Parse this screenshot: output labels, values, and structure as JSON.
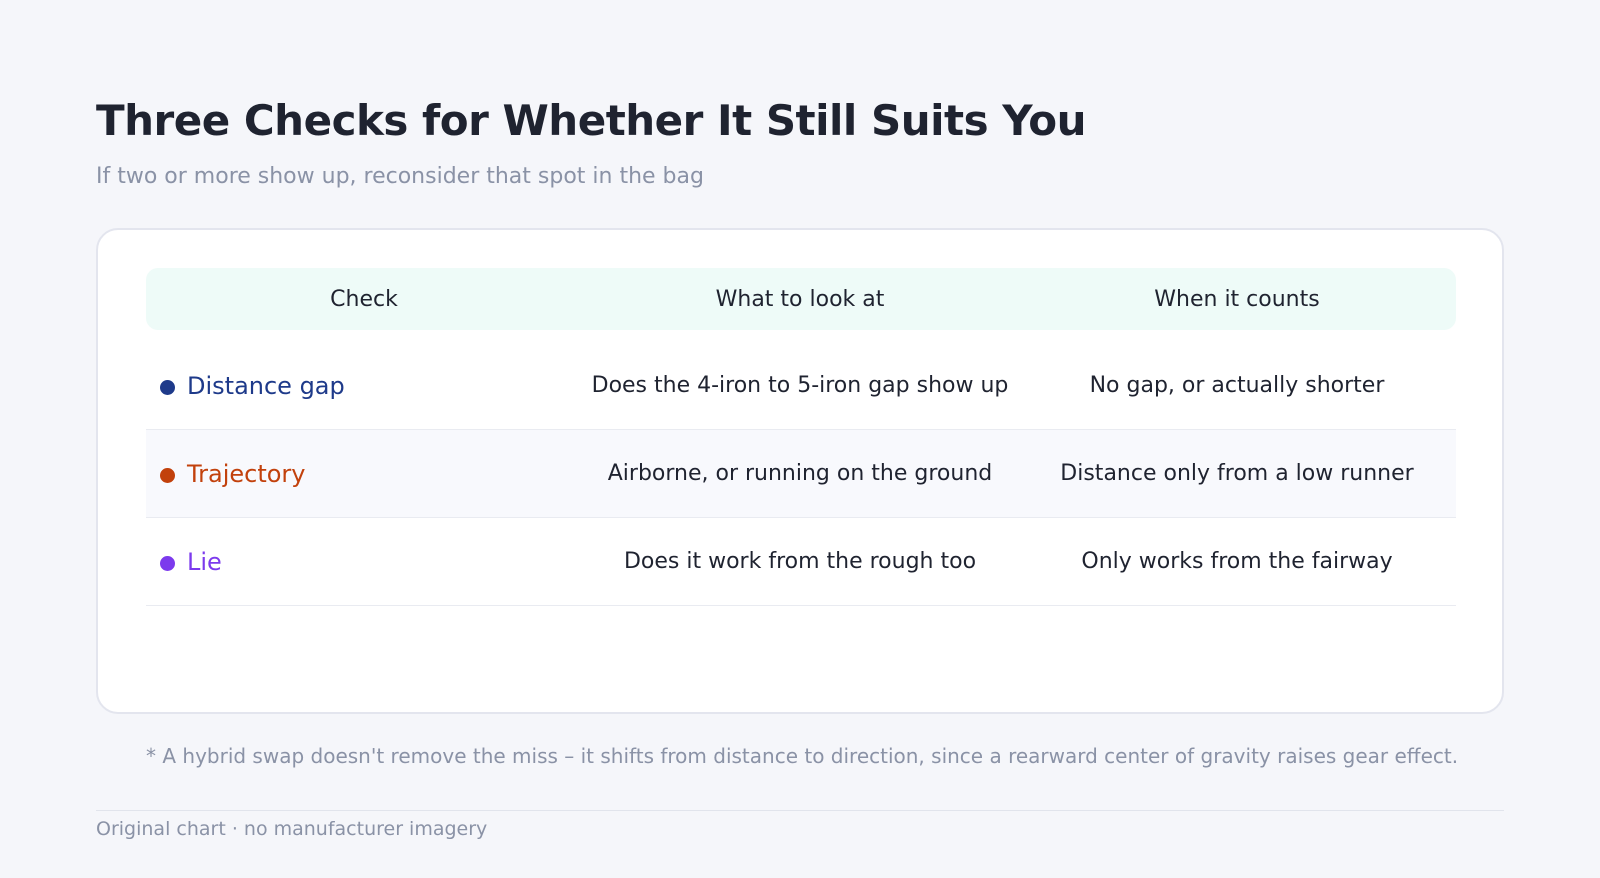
{
  "title": "Three Checks for Whether It Still Suits You",
  "subtitle": "If two or more show up, reconsider that spot in the bag",
  "table": {
    "headers": [
      "Check",
      "What to look at",
      "When it counts"
    ],
    "rows": [
      {
        "check": "Distance gap",
        "color": "#1e3a8a",
        "look_at": "Does the 4-iron to 5-iron gap show up",
        "counts": "No gap, or actually shorter"
      },
      {
        "check": "Trajectory",
        "color": "#c2410c",
        "look_at": "Airborne, or running on the ground",
        "counts": "Distance only from a low runner"
      },
      {
        "check": "Lie",
        "color": "#7c3aed",
        "look_at": "Does it work from the rough too",
        "counts": "Only works from the fairway"
      }
    ]
  },
  "footnote": "* A hybrid swap doesn't remove the miss – it shifts from distance to direction, since a rearward center of gravity raises gear effect.",
  "source": "Original chart · no manufacturer imagery"
}
